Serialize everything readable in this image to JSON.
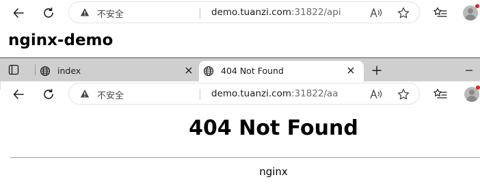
{
  "outer_browser": {
    "security_label": "不安全",
    "url_host": "demo.tuanzi.com",
    "url_rest": ":31822/api"
  },
  "page": {
    "heading": "nginx-demo"
  },
  "inner_browser": {
    "tabs": [
      {
        "title": "index",
        "active": false
      },
      {
        "title": "404 Not Found",
        "active": true
      }
    ],
    "security_label": "不安全",
    "url_host": "demo.tuanzi.com",
    "url_rest": ":31822/aa"
  },
  "error_page": {
    "title": "404 Not Found",
    "server": "nginx"
  },
  "colors": {
    "tab_strip": "#cfcfcf",
    "notification_dot": "#d22828",
    "url_path": "#6b6b6b"
  }
}
